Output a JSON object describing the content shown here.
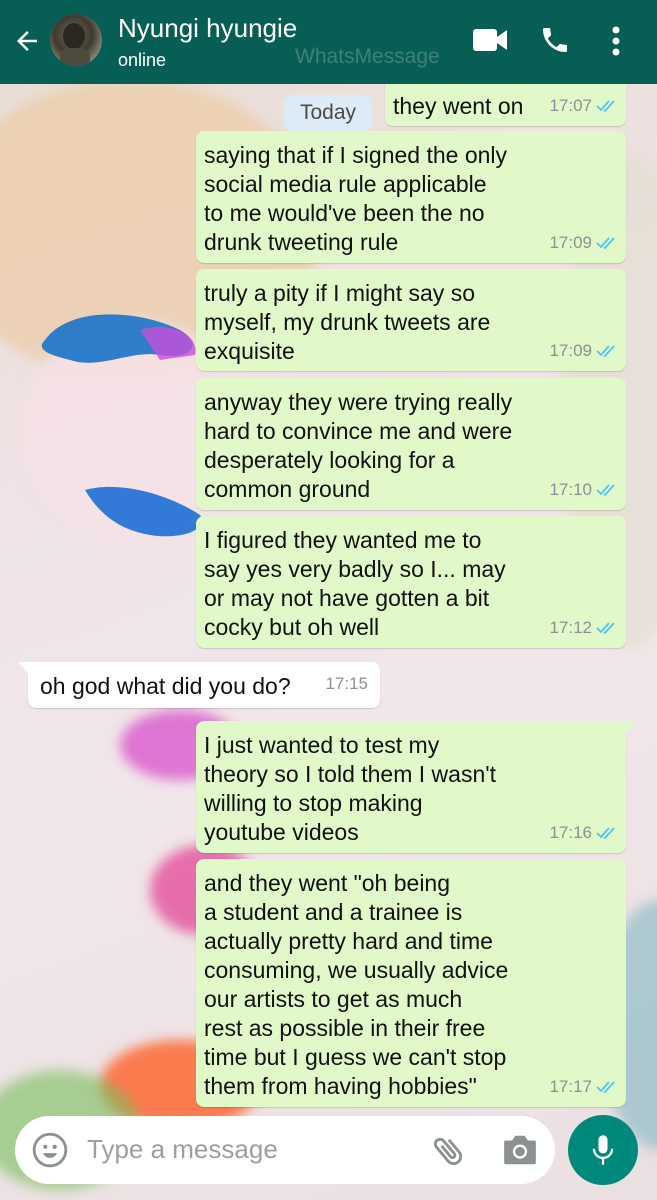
{
  "header": {
    "contact_name": "Nyungi hyungie",
    "status": "online",
    "watermark": "WhatsMessage",
    "back_icon": "arrow-back-icon",
    "video_icon": "video-call-icon",
    "call_icon": "phone-icon",
    "menu_icon": "more-vert-icon",
    "color": "#075e54"
  },
  "chat": {
    "date_label": "Today",
    "outgoing_color": "#e1f9c9",
    "incoming_color": "#ffffff",
    "tick_color": "#4fc3f7",
    "messages": [
      {
        "direction": "out",
        "text": "they went on",
        "time": "17:07",
        "read": true
      },
      {
        "direction": "out",
        "text": "saying that if I signed the only\nsocial media rule applicable\nto me would've been the no\ndrunk tweeting rule",
        "time": "17:09",
        "read": true
      },
      {
        "direction": "out",
        "text": "truly a pity if I might say so\nmyself, my drunk tweets are\nexquisite",
        "time": "17:09",
        "read": true
      },
      {
        "direction": "out",
        "text": "anyway they were trying really\nhard to convince me and were\ndesperately looking for a\ncommon ground",
        "time": "17:10",
        "read": true
      },
      {
        "direction": "out",
        "text": "I figured they wanted me to\nsay yes very badly so I... may\nor may not have gotten a bit\ncocky but oh well",
        "time": "17:12",
        "read": true
      },
      {
        "direction": "in",
        "text": "oh god what did you do?",
        "time": "17:15"
      },
      {
        "direction": "out",
        "text": "I just wanted to test my\ntheory so I told them I wasn't\nwilling to stop making\nyoutube videos",
        "time": "17:16",
        "read": true
      },
      {
        "direction": "out",
        "text": "and they went \"oh being\na student and a trainee is\nactually pretty hard and time\nconsuming, we usually advice\nour artists to get as much\nrest as possible in their free\ntime but I guess we can't stop\nthem from having hobbies\"",
        "time": "17:17",
        "read": true
      }
    ]
  },
  "composer": {
    "placeholder": "Type a message",
    "emoji_icon": "emoji-icon",
    "attach_icon": "attach-icon",
    "camera_icon": "camera-icon",
    "mic_icon": "mic-icon",
    "accent": "#00897b"
  }
}
